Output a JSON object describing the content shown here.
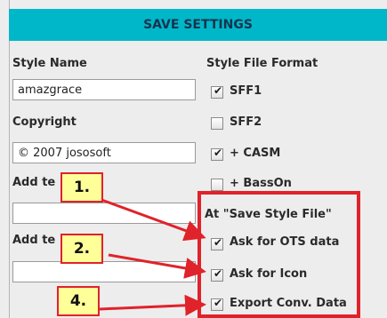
{
  "title": "SAVE SETTINGS",
  "left": {
    "style_name_label": "Style Name",
    "style_name_value": "amazgrace",
    "copyright_label": "Copyright",
    "copyright_value": "© 2007 jososoft",
    "add_text1_label": "Add te",
    "add_text2_label": "Add te"
  },
  "right": {
    "format_label": "Style File Format",
    "sff1_label": "SFF1",
    "sff1_checked": true,
    "sff2_label": "SFF2",
    "sff2_checked": false,
    "casm_label": "+ CASM",
    "casm_checked": true,
    "basson_label": "+ BassOn",
    "basson_checked": false,
    "save_section_label": "At \"Save Style File\"",
    "ots_label": "Ask for OTS data",
    "ots_checked": true,
    "icon_label": "Ask for Icon",
    "icon_checked": true,
    "export_label": "Export Conv. Data",
    "export_checked": true
  },
  "callouts": [
    "1.",
    "2.",
    "4."
  ],
  "colors": {
    "title_bg": "#00b7c9",
    "annotation_red": "#e0222b",
    "callout_bg": "#ffff9a"
  }
}
